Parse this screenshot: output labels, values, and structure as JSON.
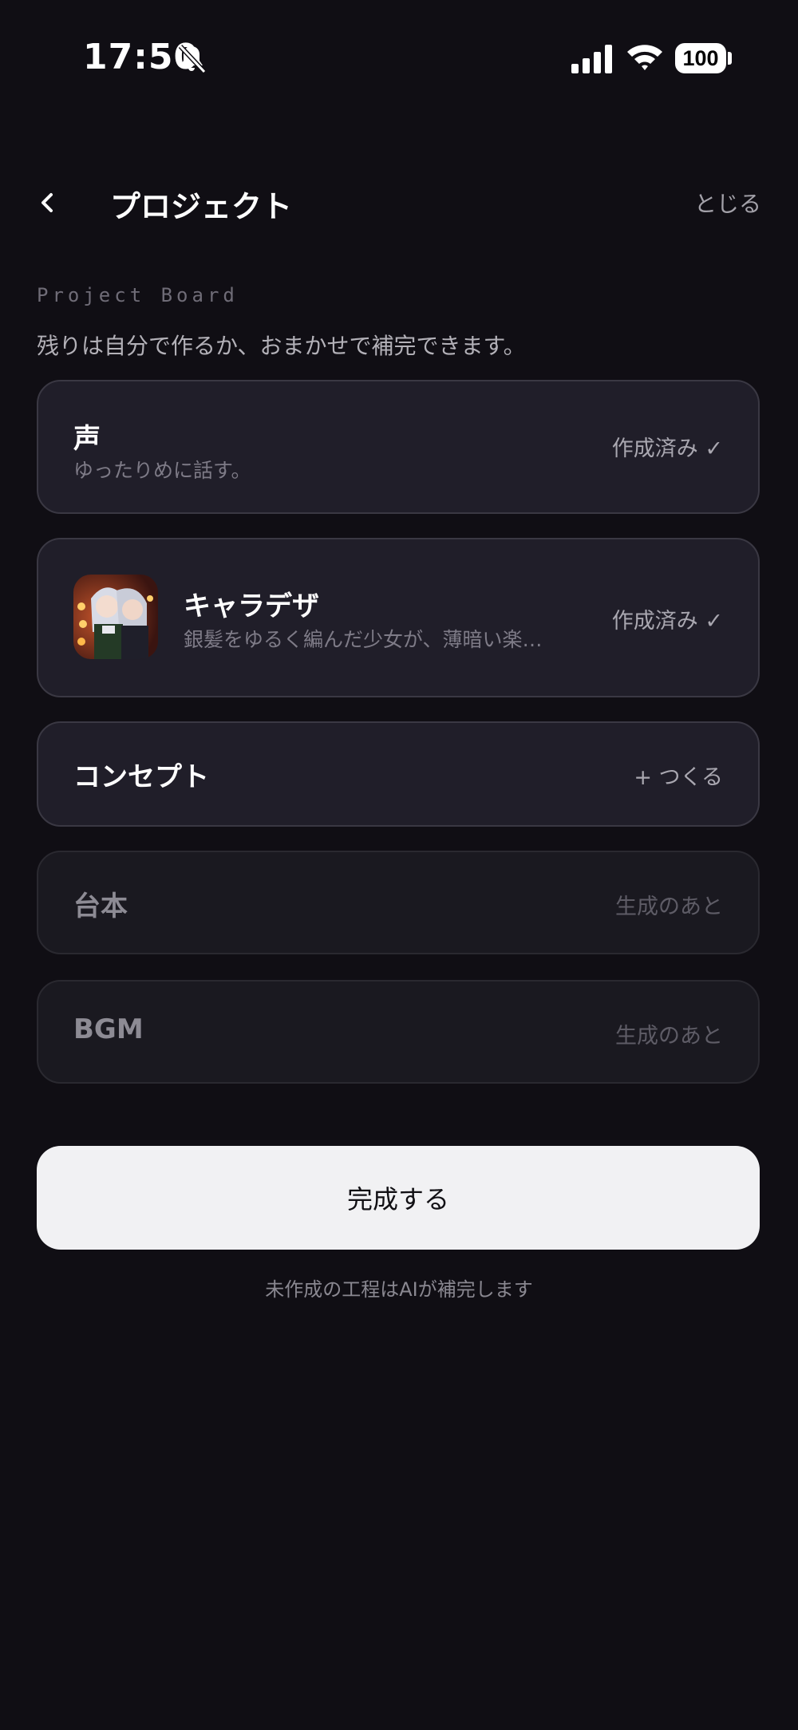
{
  "status_bar": {
    "time": "17:50",
    "battery": "100",
    "icons": [
      "bell-slash-icon",
      "signal-icon",
      "wifi-icon",
      "battery-icon"
    ]
  },
  "nav": {
    "back_icon": "chevron-left-icon",
    "title": "プロジェクト",
    "close_label": "とじる"
  },
  "board": {
    "label": "Project Board",
    "description": "残りは自分で作るか、おまかせで補完できます。"
  },
  "cards": [
    {
      "title": "声",
      "subtitle": "ゆったりめに話す。",
      "status": "作成済み ✓",
      "state": "done"
    },
    {
      "title": "キャラデザ",
      "subtitle": "銀髪をゆるく編んだ少女が、薄暗い楽…",
      "status": "作成済み ✓",
      "state": "done",
      "thumbnail_icon": "character-thumbnail"
    },
    {
      "title": "コンセプト",
      "status": "+  つくる",
      "state": "actionable"
    },
    {
      "title": "台本",
      "status": "生成のあと",
      "state": "disabled"
    },
    {
      "title": "BGM",
      "status": "生成のあと",
      "state": "disabled"
    }
  ],
  "complete_button": "完成する",
  "footnote": "未作成の工程はAIが補完します",
  "colors": {
    "background": "#100e14",
    "card": "#201e29",
    "card_disabled": "#1a1920",
    "button": "#f1f1f3"
  }
}
